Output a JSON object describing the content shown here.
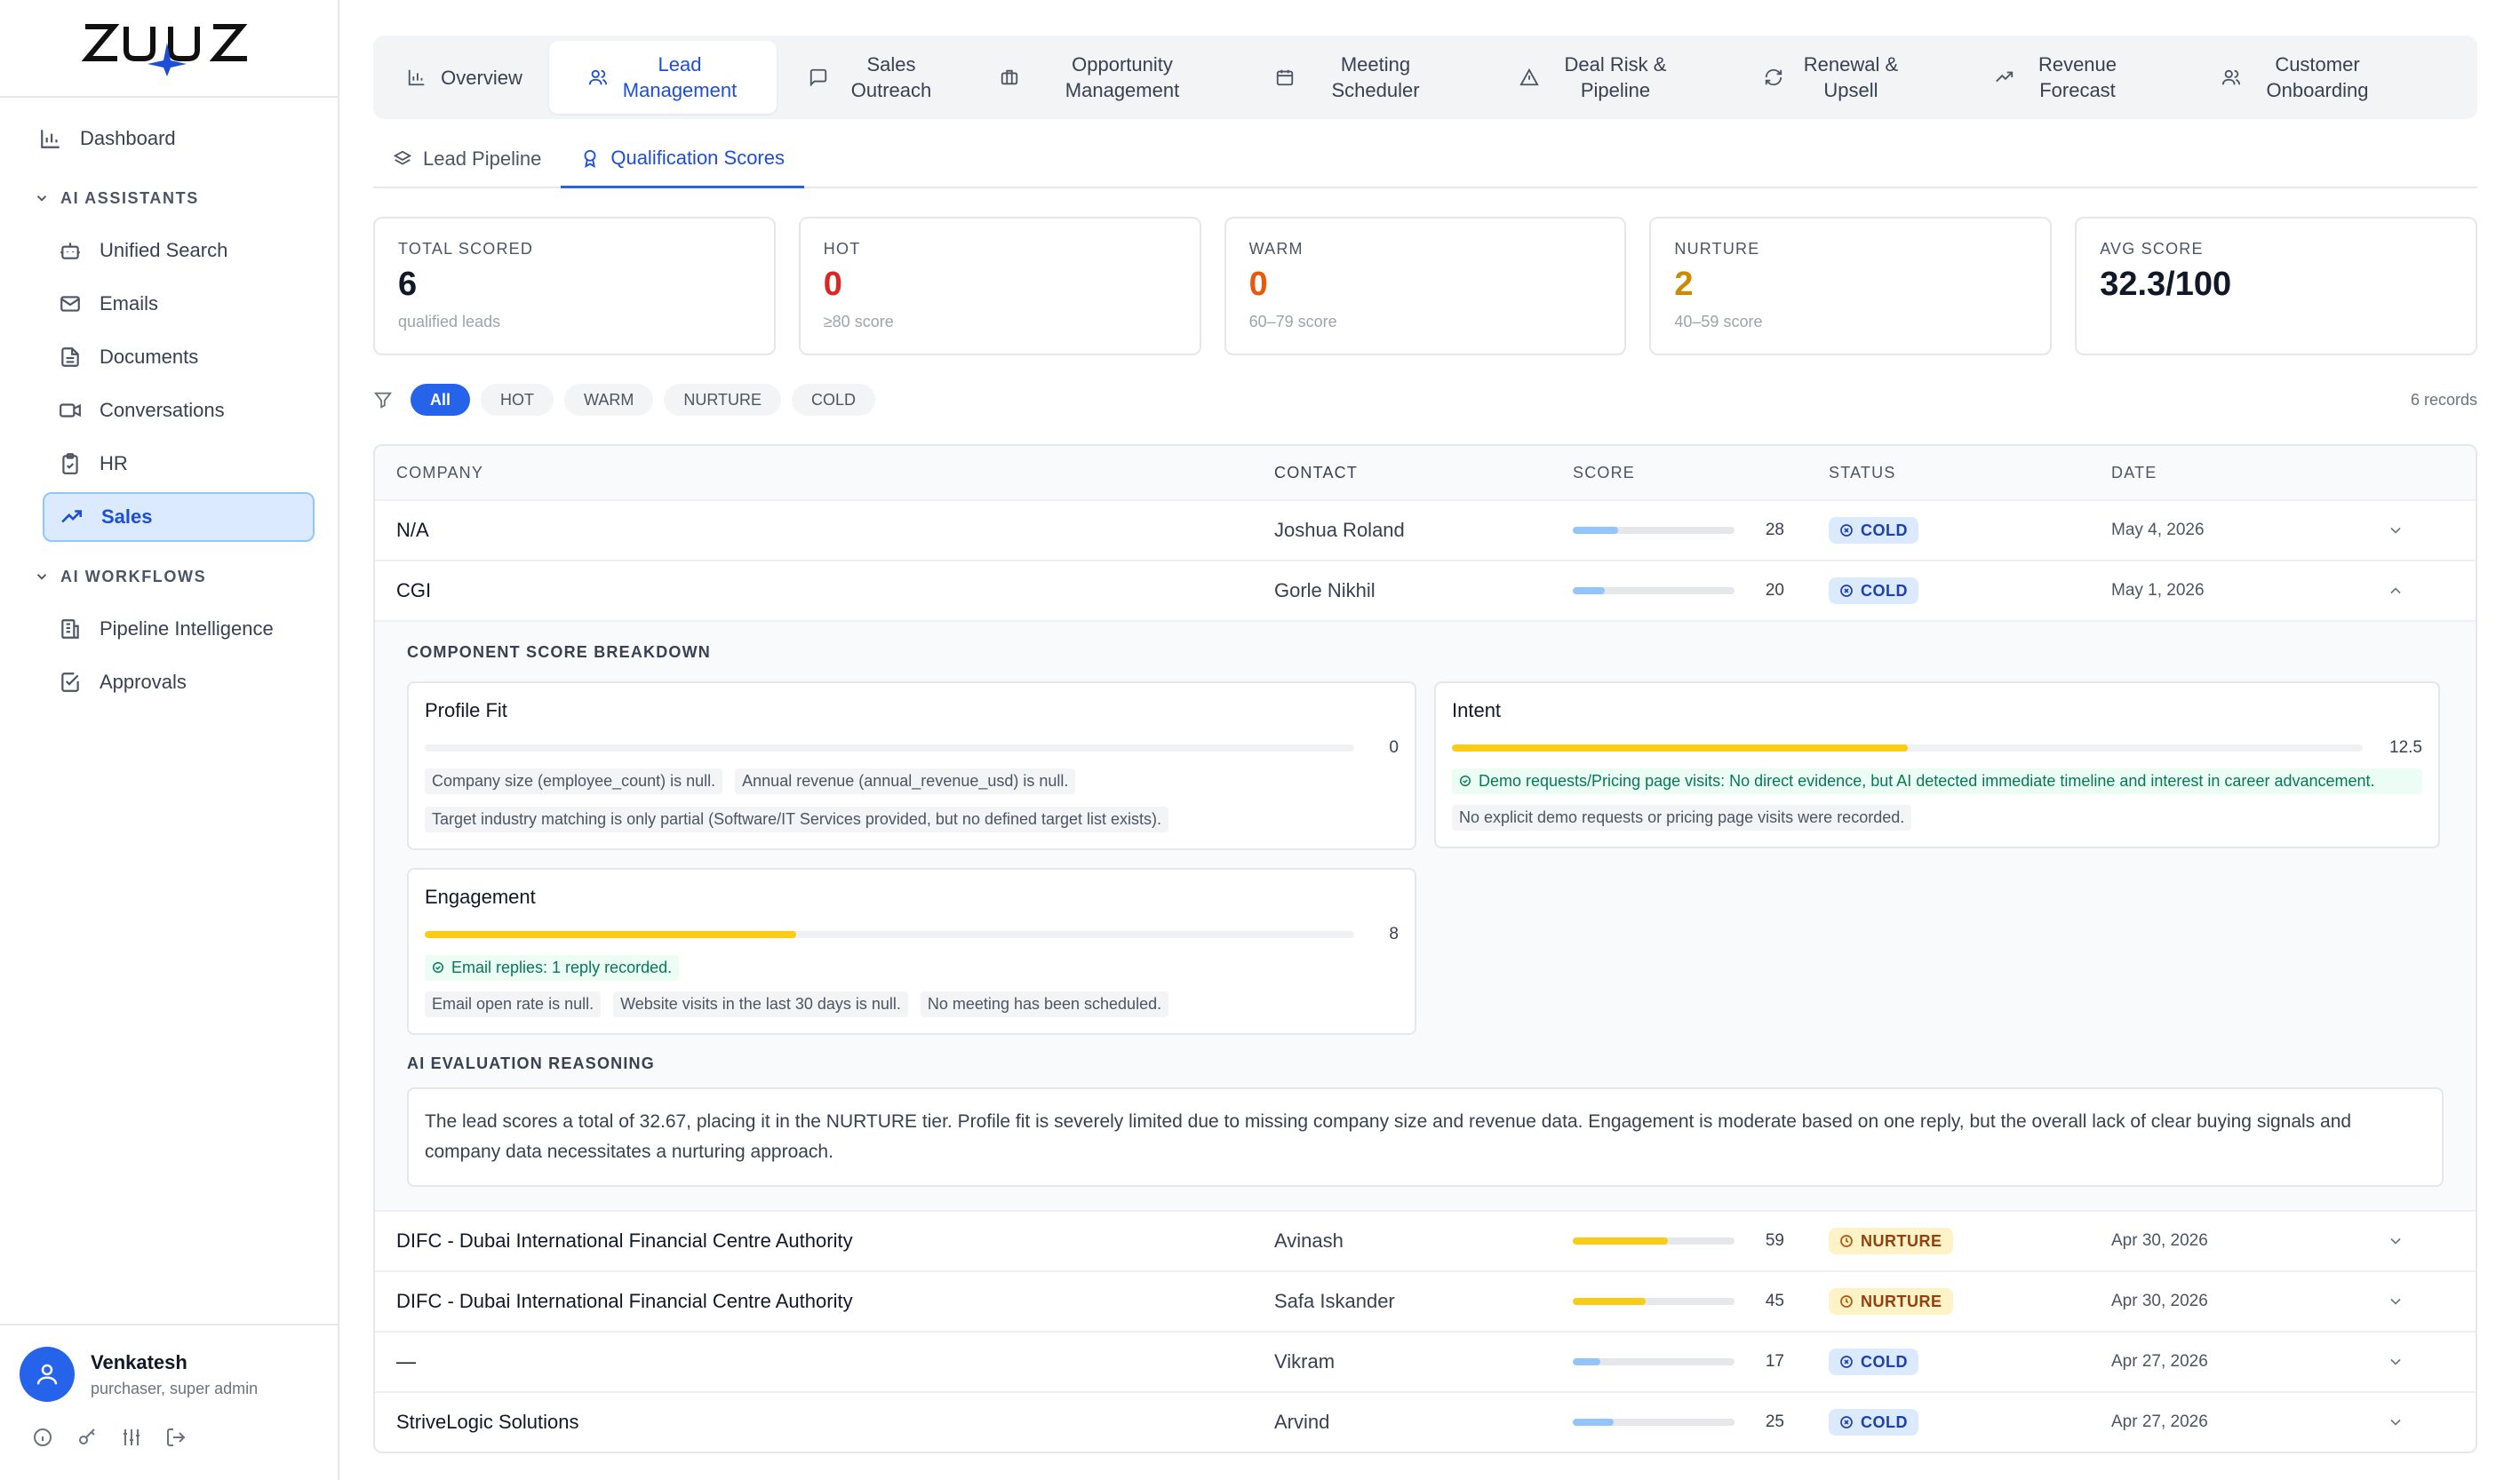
{
  "brand": {
    "logo_text": "ZUUS",
    "accent": "#2563eb"
  },
  "sidebar": {
    "dashboard": "Dashboard",
    "ai_assistants_label": "AI ASSISTANTS",
    "assistants": [
      {
        "label": "Unified Search",
        "icon": "robot-icon"
      },
      {
        "label": "Emails",
        "icon": "mail-icon"
      },
      {
        "label": "Documents",
        "icon": "document-icon"
      },
      {
        "label": "Conversations",
        "icon": "video-icon"
      },
      {
        "label": "HR",
        "icon": "clipboard-icon"
      },
      {
        "label": "Sales",
        "icon": "trending-up-icon"
      }
    ],
    "ai_workflows_label": "AI WORKFLOWS",
    "workflows": [
      {
        "label": "Pipeline Intelligence",
        "icon": "building-icon"
      },
      {
        "label": "Approvals",
        "icon": "checkbox-icon"
      }
    ],
    "user": {
      "name": "Venkatesh",
      "role": "purchaser, super admin"
    }
  },
  "tabs": [
    {
      "label": "Overview",
      "icon": "bar-chart-icon"
    },
    {
      "label": "Lead Management",
      "icon": "users-icon"
    },
    {
      "label": "Sales Outreach",
      "icon": "message-icon"
    },
    {
      "label": "Opportunity Management",
      "icon": "briefcase-icon"
    },
    {
      "label": "Meeting Scheduler",
      "icon": "calendar-icon"
    },
    {
      "label": "Deal Risk & Pipeline",
      "icon": "warning-icon"
    },
    {
      "label": "Renewal & Upsell",
      "icon": "refresh-icon"
    },
    {
      "label": "Revenue Forecast",
      "icon": "trending-up-icon"
    },
    {
      "label": "Customer Onboarding",
      "icon": "users-icon"
    }
  ],
  "subtabs": [
    {
      "label": "Lead Pipeline",
      "icon": "layers-icon"
    },
    {
      "label": "Qualification Scores",
      "icon": "award-icon"
    }
  ],
  "stats": [
    {
      "label": "TOTAL SCORED",
      "value": "6",
      "sub": "qualified leads",
      "color": "#111827"
    },
    {
      "label": "HOT",
      "value": "0",
      "sub": "≥80 score",
      "color": "#dc2626"
    },
    {
      "label": "WARM",
      "value": "0",
      "sub": "60–79 score",
      "color": "#ea580c"
    },
    {
      "label": "NURTURE",
      "value": "2",
      "sub": "40–59 score",
      "color": "#ca8a04"
    },
    {
      "label": "AVG SCORE",
      "value": "32.3/100",
      "sub": "",
      "color": "#111827"
    }
  ],
  "filters": [
    "All",
    "HOT",
    "WARM",
    "NURTURE",
    "COLD"
  ],
  "records": "6 records",
  "table": {
    "headers": {
      "company": "COMPANY",
      "contact": "CONTACT",
      "score": "SCORE",
      "status": "STATUS",
      "date": "DATE"
    },
    "rows": [
      {
        "company": "N/A",
        "contact": "Joshua Roland",
        "score": "28",
        "score_pct": 0.28,
        "status": "COLD",
        "date": "May 4, 2026",
        "expanded": false
      },
      {
        "company": "CGI",
        "contact": "Gorle Nikhil",
        "score": "20",
        "score_pct": 0.2,
        "status": "COLD",
        "date": "May 1, 2026",
        "expanded": true
      },
      {
        "company": "DIFC - Dubai International Financial Centre Authority",
        "contact": "Avinash",
        "score": "59",
        "score_pct": 0.59,
        "status": "NURTURE",
        "date": "Apr 30, 2026",
        "expanded": false
      },
      {
        "company": "DIFC - Dubai International Financial Centre Authority",
        "contact": "Safa Iskander",
        "score": "45",
        "score_pct": 0.45,
        "status": "NURTURE",
        "date": "Apr 30, 2026",
        "expanded": false
      },
      {
        "company": "—",
        "contact": "Vikram",
        "score": "17",
        "score_pct": 0.17,
        "status": "COLD",
        "date": "Apr 27, 2026",
        "expanded": false
      },
      {
        "company": "StriveLogic Solutions",
        "contact": "Arvind",
        "score": "25",
        "score_pct": 0.25,
        "status": "COLD",
        "date": "Apr 27, 2026",
        "expanded": false
      }
    ]
  },
  "breakdown": {
    "title": "COMPONENT SCORE BREAKDOWN",
    "profile_fit": {
      "title": "Profile Fit",
      "value": "0",
      "pct": 0.0,
      "positives": [],
      "notes": [
        "Company size (employee_count) is null.",
        "Annual revenue (annual_revenue_usd) is null.",
        "Target industry matching is only partial (Software/IT Services provided, but no defined target list exists)."
      ]
    },
    "intent": {
      "title": "Intent",
      "value": "12.5",
      "pct": 0.5,
      "positives": [
        "Demo requests/Pricing page visits: No direct evidence, but AI detected immediate timeline and interest in career advancement."
      ],
      "notes": [
        "No explicit demo requests or pricing page visits were recorded."
      ]
    },
    "engagement": {
      "title": "Engagement",
      "value": "8",
      "pct": 0.4,
      "positives": [
        "Email replies: 1 reply recorded."
      ],
      "notes": [
        "Email open rate is null.",
        "Website visits in the last 30 days is null.",
        "No meeting has been scheduled."
      ]
    },
    "reasoning_title": "AI EVALUATION REASONING",
    "reasoning": "The lead scores a total of 32.67, placing it in the NURTURE tier. Profile fit is severely limited due to missing company size and revenue data. Engagement is moderate based on one reply, but the overall lack of clear buying signals and company data necessitates a nurturing approach."
  }
}
